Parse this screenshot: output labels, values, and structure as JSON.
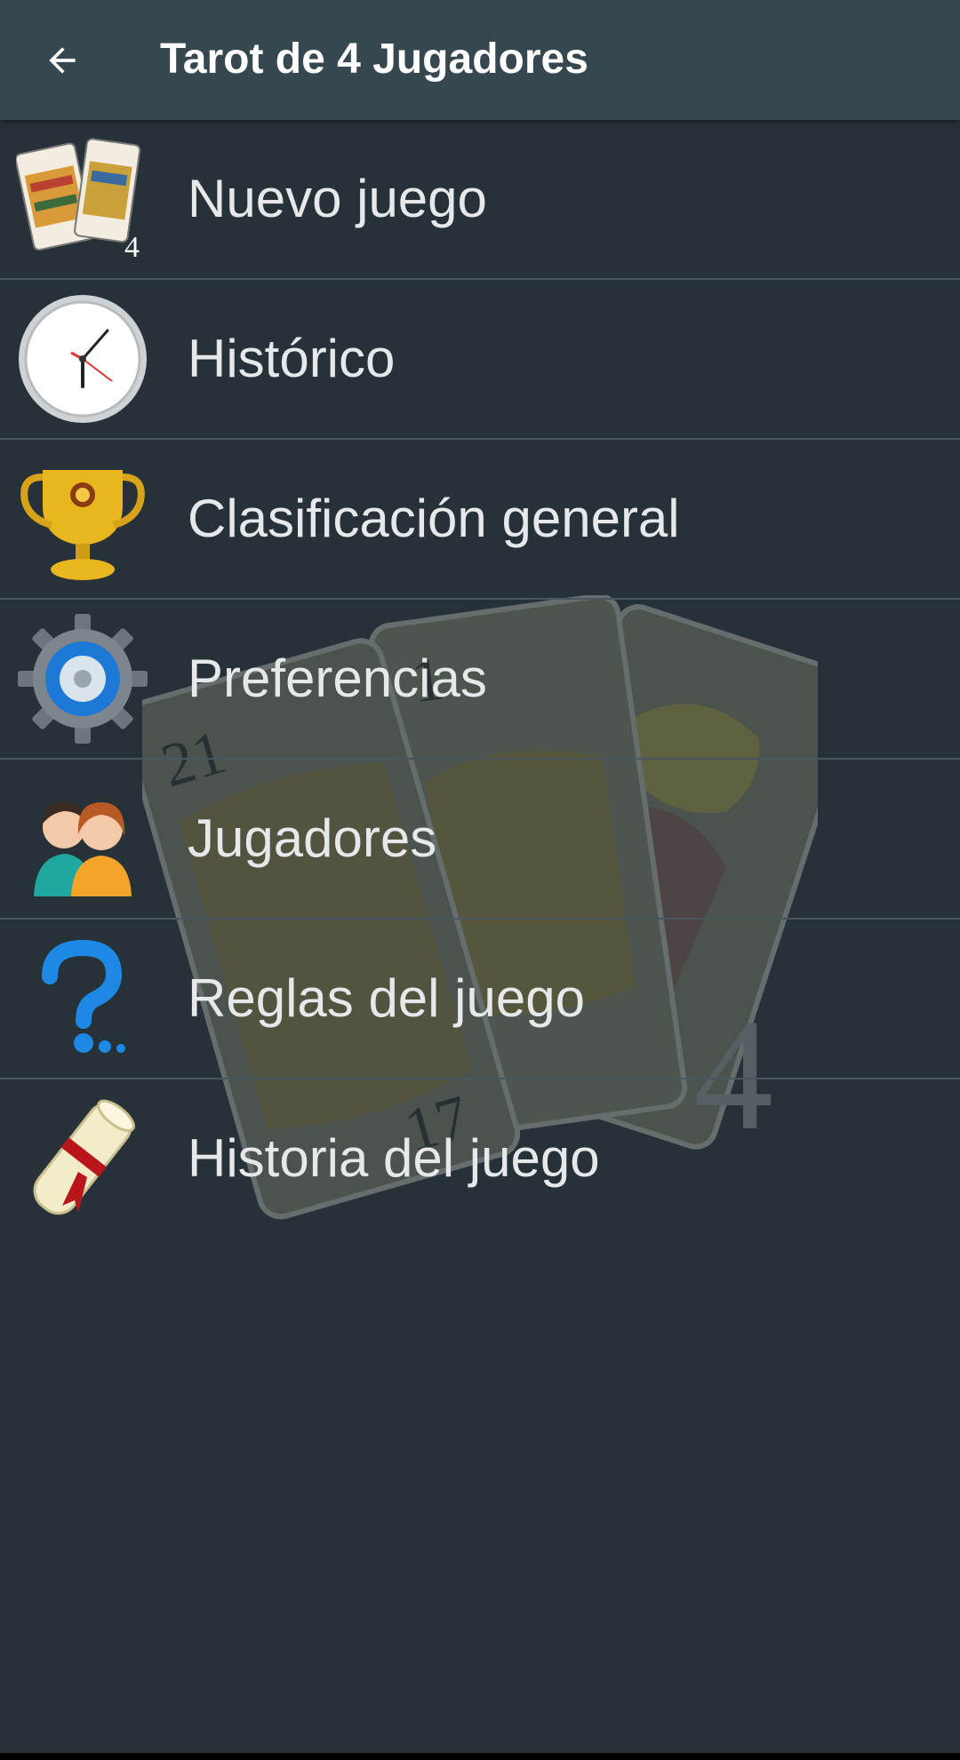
{
  "app_bar": {
    "title": "Tarot de 4 Jugadores",
    "back_icon": "arrow-back-icon"
  },
  "menu": {
    "items": [
      {
        "label": "Nuevo juego",
        "icon": "tarot-cards-icon",
        "badge": "4"
      },
      {
        "label": "Histórico",
        "icon": "clock-icon"
      },
      {
        "label": "Clasificación general",
        "icon": "trophy-icon"
      },
      {
        "label": "Preferencias",
        "icon": "gear-icon"
      },
      {
        "label": "Jugadores",
        "icon": "players-icon"
      },
      {
        "label": "Reglas del juego",
        "icon": "question-mark-icon"
      },
      {
        "label": "Historia del juego",
        "icon": "scroll-icon"
      }
    ]
  },
  "background_art": {
    "card_numbers": [
      "21",
      "1",
      "17"
    ],
    "badge": "4"
  },
  "colors": {
    "background": "#263238",
    "app_bar": "#37474f",
    "text": "#e6e8ea",
    "divider": "#4a565d"
  }
}
